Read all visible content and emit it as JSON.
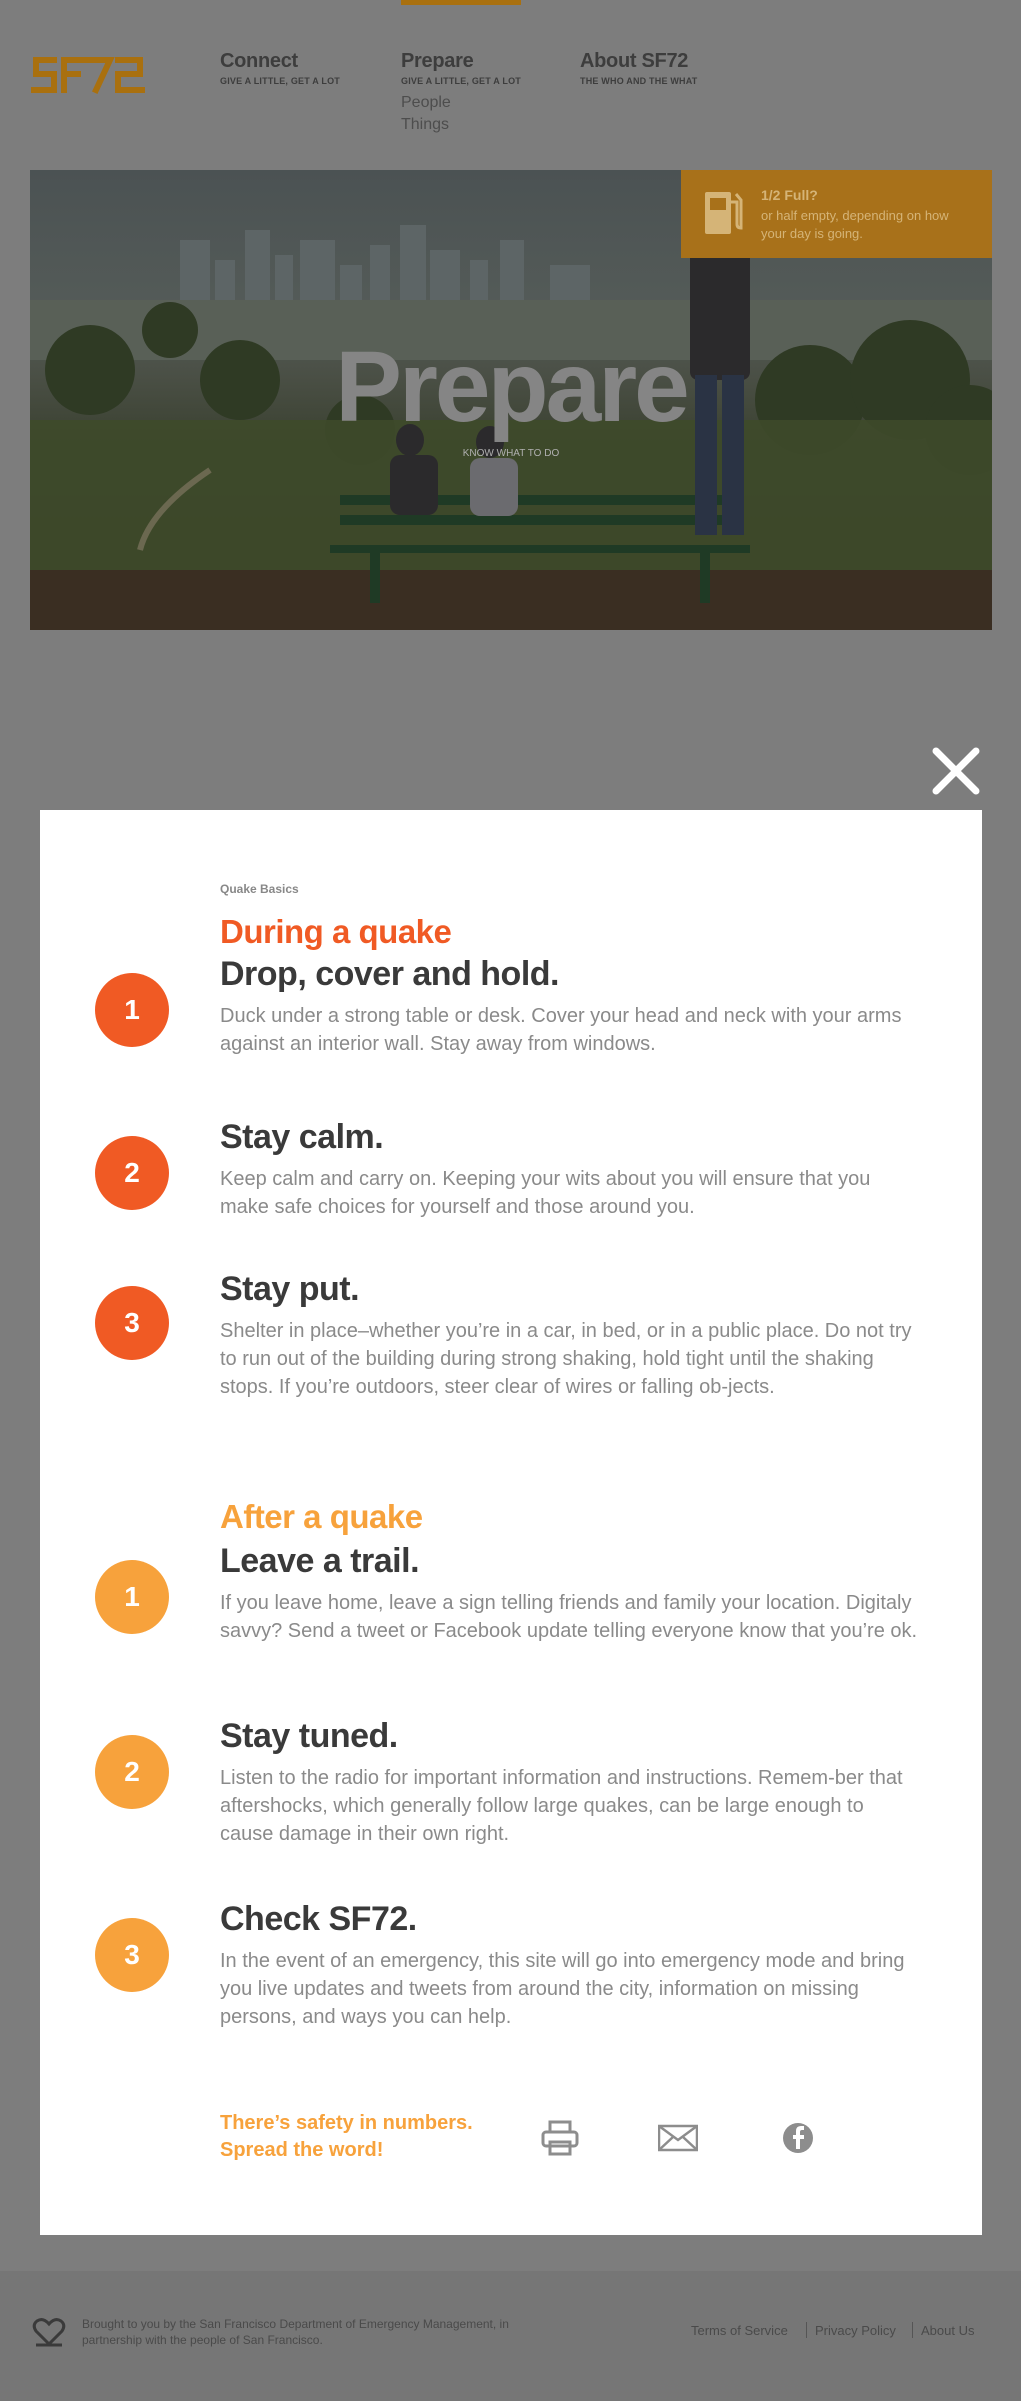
{
  "header": {
    "logo": "SF72",
    "nav": [
      {
        "title": "Connect",
        "subtitle": "GIVE A LITTLE, GET A LOT"
      },
      {
        "title": "Prepare",
        "subtitle": "GIVE A LITTLE, GET A LOT",
        "links": [
          "People",
          "Things"
        ]
      },
      {
        "title": "About SF72",
        "subtitle": "THE WHO AND THE WHAT"
      }
    ]
  },
  "hero": {
    "title": "Prepare",
    "subtitle": "KNOW WHAT TO DO",
    "promo": {
      "icon": "fuel-pump-icon",
      "title": "1/2 Full?",
      "text": "or half empty, depending on how your day is going."
    }
  },
  "modal": {
    "close_icon": "close-icon",
    "kicker": "Quake Basics",
    "during": {
      "title": "During a quake",
      "color": "#f05a24",
      "steps": [
        {
          "num": "1",
          "heading": "Drop, cover and hold.",
          "text": "Duck under a strong table or desk. Cover your head and neck with your arms against an interior wall. Stay away from windows."
        },
        {
          "num": "2",
          "heading": "Stay calm.",
          "text": "Keep calm and carry on. Keeping your wits about you will ensure that you make safe choices for yourself and those around you."
        },
        {
          "num": "3",
          "heading": "Stay put.",
          "text": "Shelter in place–whether you’re in a car, in bed, or in a public place. Do not try to run out of the building during strong shaking, hold tight until the shaking stops. If you’re outdoors, steer clear of wires or falling ob-jects."
        }
      ]
    },
    "after": {
      "title": "After a quake",
      "color": "#f7a23c",
      "steps": [
        {
          "num": "1",
          "heading": "Leave a trail.",
          "text": "If you leave home, leave a sign telling friends and family your location. Digitaly savvy? Send a tweet or Facebook update telling everyone know that you’re ok."
        },
        {
          "num": "2",
          "heading": "Stay tuned.",
          "text": "Listen to the radio for important information and instructions. Remem-ber that aftershocks, which generally follow large quakes, can be large enough to cause damage in their own right."
        },
        {
          "num": "3",
          "heading": "Check SF72.",
          "text": "In the event of an emergency, this site will go into emergency mode and bring you live updates and tweets from around the city, information on missing persons, and ways you can help."
        }
      ]
    },
    "share": {
      "line1": "There’s safety in numbers.",
      "line2": "Spread the word!",
      "icons": [
        "print-icon",
        "email-icon",
        "facebook-icon"
      ]
    }
  },
  "footer": {
    "icon": "heart-icon",
    "text": "Brought to you by the San Francisco Department of Emergency Management, in partnership with the people of San Francisco.",
    "links": [
      "Terms of Service",
      "Privacy Policy",
      "About Us"
    ]
  }
}
